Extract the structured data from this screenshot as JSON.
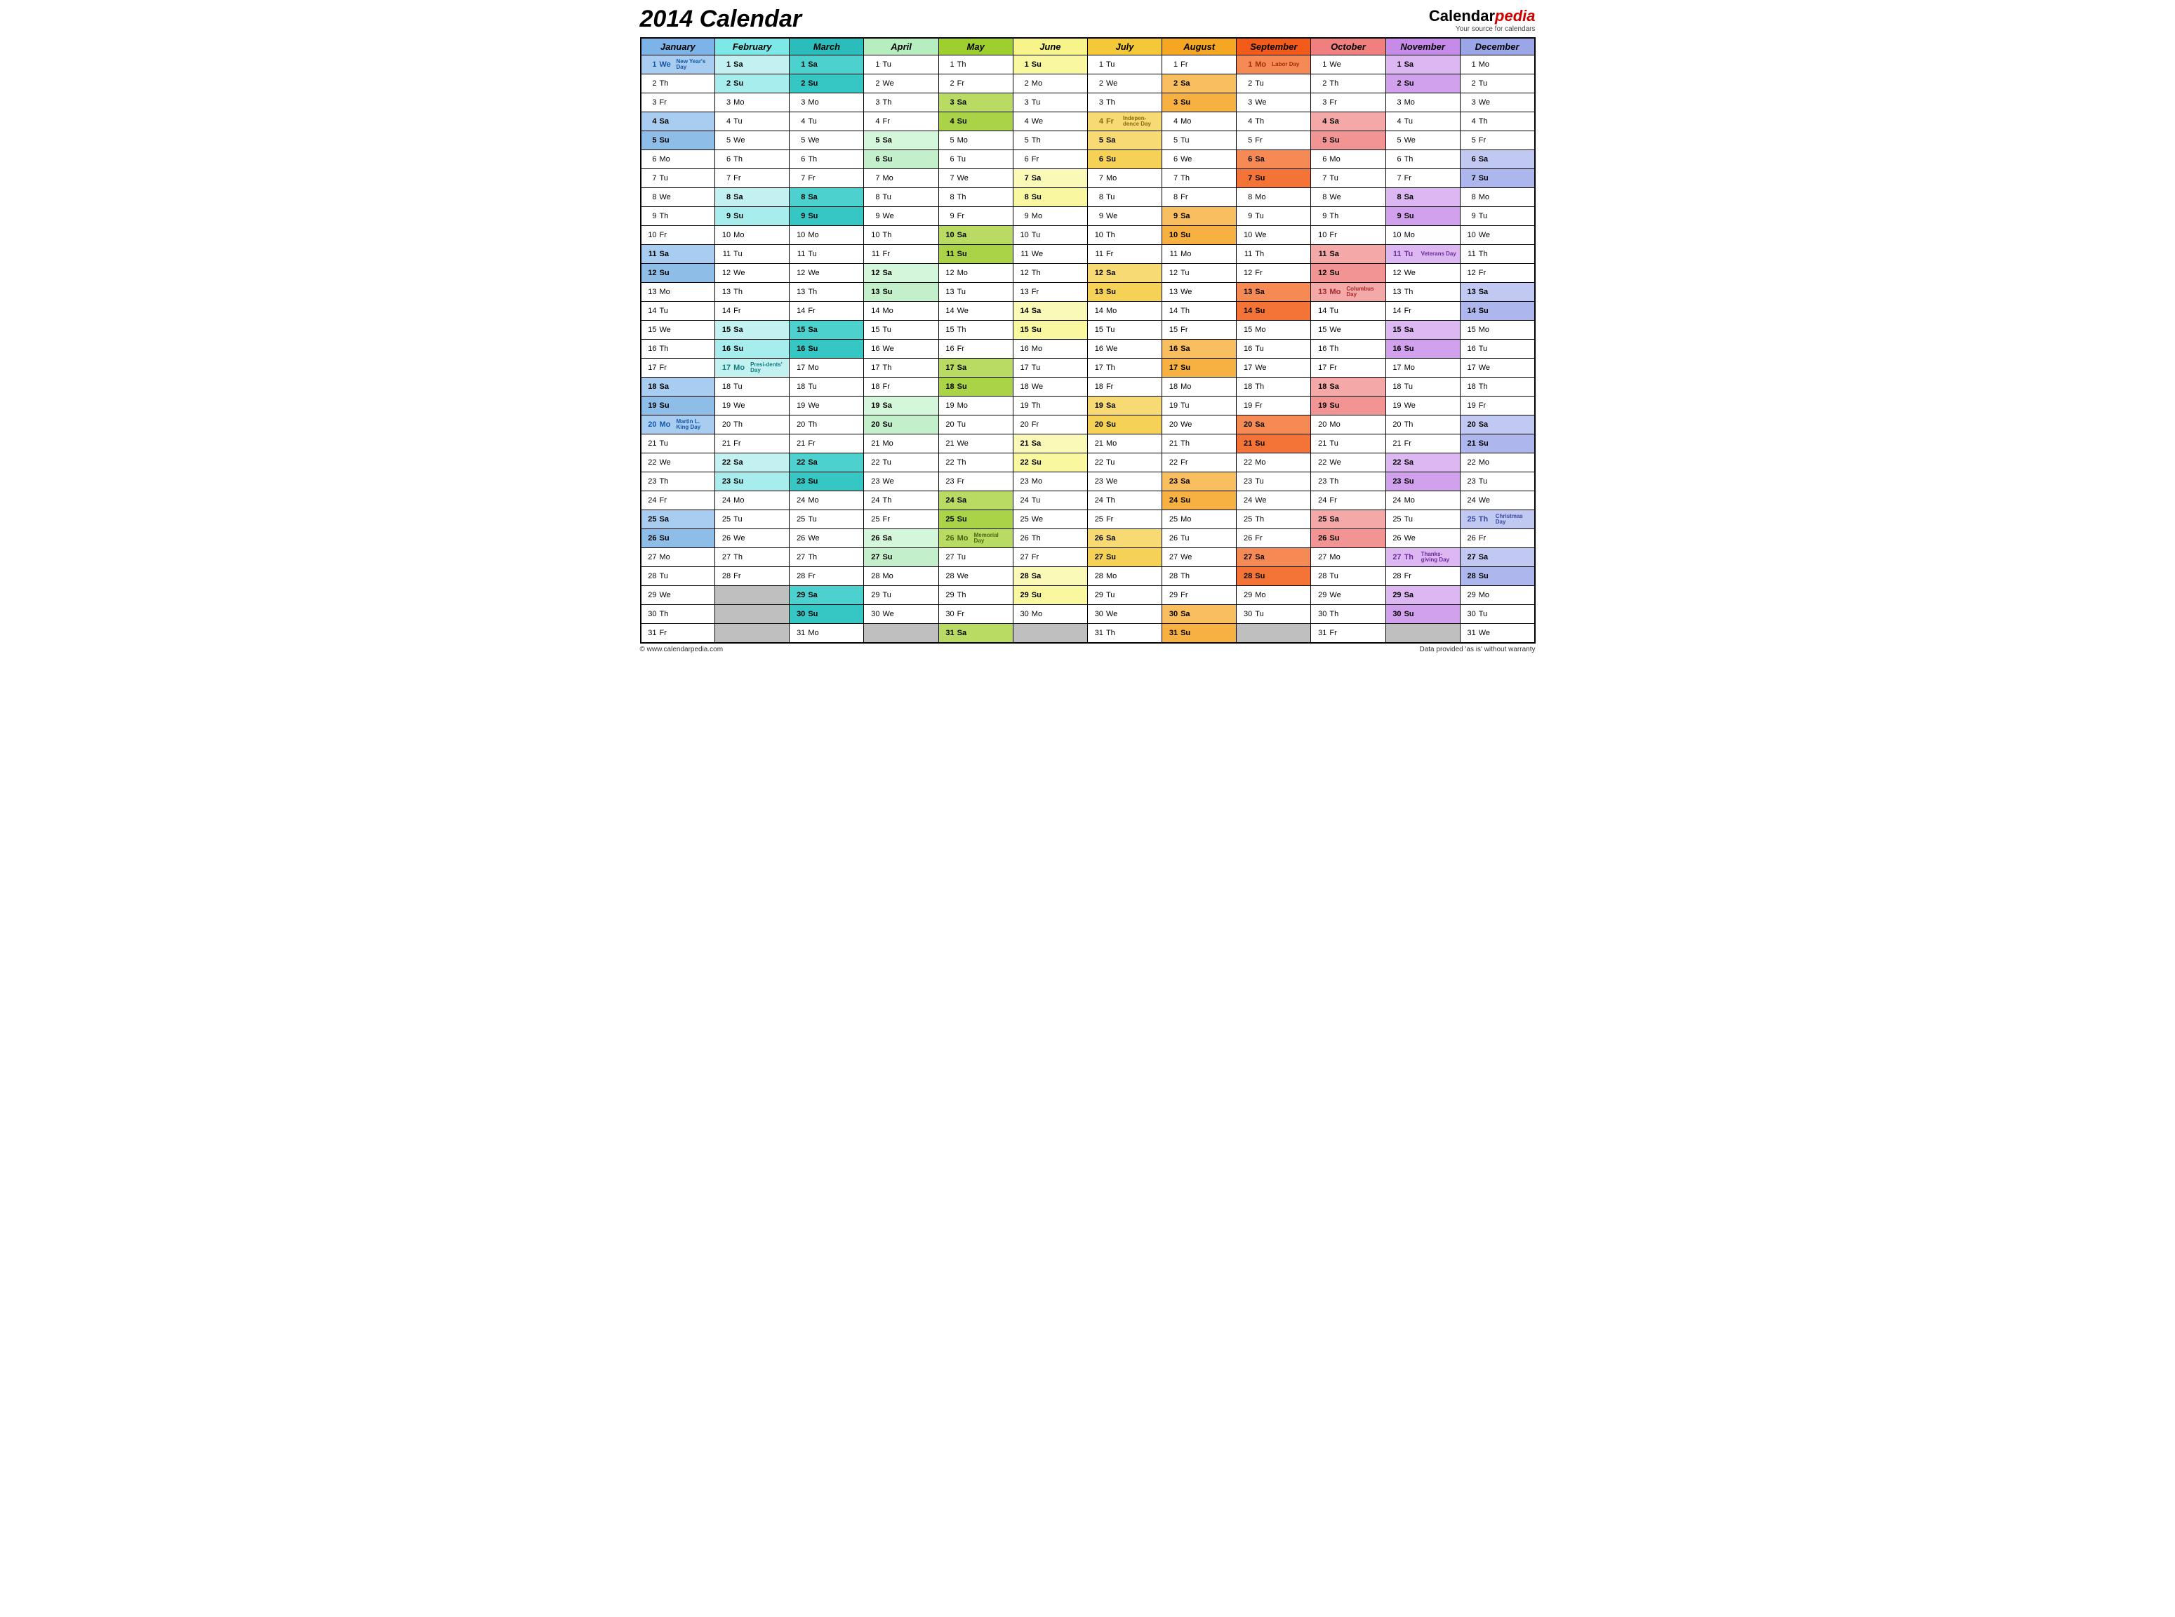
{
  "title": "2014 Calendar",
  "brand_main": "Calendar",
  "brand_accent": "pedia",
  "brand_tag": "Your source for calendars",
  "footer_left": "© www.calendarpedia.com",
  "footer_right": "Data provided 'as is' without warranty",
  "dow": [
    "Mo",
    "Tu",
    "We",
    "Th",
    "Fr",
    "Sa",
    "Su"
  ],
  "months": [
    {
      "name": "January",
      "len": 31,
      "start": 2,
      "hdr": "#7db4e8",
      "wl": "#a8cdf0",
      "wd": "#8ebde8",
      "hcol": "#1556a8",
      "holidays": {
        "1": "New Year's Day",
        "20": "Martin L. King Day"
      }
    },
    {
      "name": "February",
      "len": 28,
      "start": 5,
      "hdr": "#7de8e8",
      "wl": "#c3f1f1",
      "wd": "#a7eded",
      "hcol": "#127d7d",
      "holidays": {
        "17": "Presi-dents' Day"
      }
    },
    {
      "name": "March",
      "len": 31,
      "start": 5,
      "hdr": "#2bbdbb",
      "wl": "#4dd1cf",
      "wd": "#36c6c4",
      "hcol": "#0b6a69",
      "holidays": {}
    },
    {
      "name": "April",
      "len": 30,
      "start": 1,
      "hdr": "#b6eec0",
      "wl": "#d4f6da",
      "wd": "#c3f0cb",
      "hcol": "#2a8a3a",
      "holidays": {}
    },
    {
      "name": "May",
      "len": 31,
      "start": 3,
      "hdr": "#9fcf2e",
      "wl": "#b9db63",
      "wd": "#abd347",
      "hcol": "#4a6610",
      "holidays": {
        "26": "Memorial Day"
      }
    },
    {
      "name": "June",
      "len": 30,
      "start": 6,
      "hdr": "#f7f58a",
      "wl": "#fbf9b8",
      "wd": "#f9f79f",
      "hcol": "#8a8810",
      "holidays": {}
    },
    {
      "name": "July",
      "len": 31,
      "start": 1,
      "hdr": "#f3c939",
      "wl": "#f7da74",
      "wd": "#f5d155",
      "hcol": "#8a6a10",
      "holidays": {
        "4": "Indepen-dence Day"
      }
    },
    {
      "name": "August",
      "len": 31,
      "start": 4,
      "hdr": "#f5a623",
      "wl": "#f8be5f",
      "wd": "#f7b142",
      "hcol": "#8a5510",
      "holidays": {}
    },
    {
      "name": "September",
      "len": 30,
      "start": 0,
      "hdr": "#f25b1a",
      "wl": "#f68a55",
      "wd": "#f47336",
      "hcol": "#a03008",
      "holidays": {
        "1": "Labor Day"
      }
    },
    {
      "name": "October",
      "len": 31,
      "start": 2,
      "hdr": "#f08080",
      "wl": "#f5a8a8",
      "wd": "#f29494",
      "hcol": "#a02a2a",
      "holidays": {
        "13": "Columbus Day"
      }
    },
    {
      "name": "November",
      "len": 30,
      "start": 5,
      "hdr": "#c68ae8",
      "wl": "#dcb7f1",
      "wd": "#d1a1ed",
      "hcol": "#6a2b9a",
      "holidays": {
        "11": "Veterans Day",
        "27": "Thanks-giving Day"
      }
    },
    {
      "name": "December",
      "len": 31,
      "start": 0,
      "hdr": "#9aa6e8",
      "wl": "#c1c8f1",
      "wd": "#adb6ed",
      "hcol": "#3a4aa0",
      "holidays": {
        "25": "Christmas Day"
      }
    }
  ]
}
